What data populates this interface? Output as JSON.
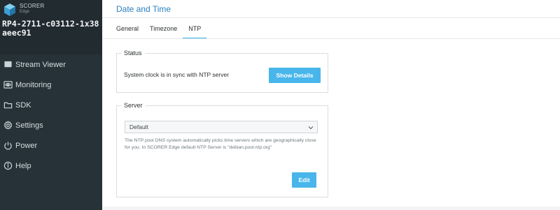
{
  "sidebar": {
    "brand_name": "SCORER",
    "brand_sub": "Edge",
    "device_name": "RP4-2711-c03112-1x38aeec91",
    "items": [
      {
        "label": "Stream Viewer",
        "icon": "stream-viewer-icon"
      },
      {
        "label": "Monitoring",
        "icon": "monitoring-eye-icon"
      },
      {
        "label": "SDK",
        "icon": "folder-icon"
      },
      {
        "label": "Settings",
        "icon": "gear-icon"
      },
      {
        "label": "Power",
        "icon": "power-icon"
      },
      {
        "label": "Help",
        "icon": "help-info-icon"
      }
    ]
  },
  "main": {
    "title": "Date and Time",
    "tabs": [
      {
        "label": "General",
        "active": false
      },
      {
        "label": "Timezone",
        "active": false
      },
      {
        "label": "NTP",
        "active": true
      }
    ],
    "status": {
      "legend": "Status",
      "text": "System clock is in sync with NTP server",
      "button_label": "Show Details"
    },
    "server": {
      "legend": "Server",
      "selected": "Default",
      "description": "The NTP pool DNS system automatically picks time servers which are geographically close for you. In SCORER Edge default NTP Server is \"debian.pool.ntp.org\"",
      "button_label": "Edit"
    }
  },
  "colors": {
    "sidebar_bg": "#263238",
    "accent": "#48b6ea",
    "title": "#2a7fbf"
  }
}
